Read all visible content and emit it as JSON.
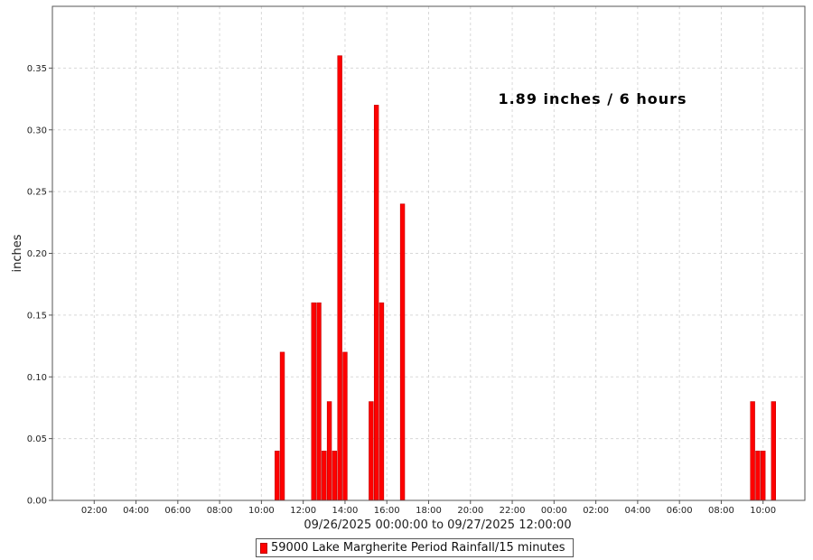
{
  "chart_data": {
    "type": "bar",
    "ylabel": "inches",
    "xlabel": "09/26/2025 00:00:00 to 09/27/2025 12:00:00",
    "x_range": [
      "2025-09-26 00:00",
      "2025-09-27 12:00"
    ],
    "ylim": [
      0,
      0.4
    ],
    "y_ticks": [
      0.0,
      0.05,
      0.1,
      0.15,
      0.2,
      0.25,
      0.3,
      0.35
    ],
    "y_tick_labels": [
      "0.00",
      "0.05",
      "0.10",
      "0.15",
      "0.20",
      "0.25",
      "0.30",
      "0.35"
    ],
    "x_ticks": [
      "2025-09-26 02:00",
      "2025-09-26 04:00",
      "2025-09-26 06:00",
      "2025-09-26 08:00",
      "2025-09-26 10:00",
      "2025-09-26 12:00",
      "2025-09-26 14:00",
      "2025-09-26 16:00",
      "2025-09-26 18:00",
      "2025-09-26 20:00",
      "2025-09-26 22:00",
      "2025-09-27 00:00",
      "2025-09-27 02:00",
      "2025-09-27 04:00",
      "2025-09-27 06:00",
      "2025-09-27 08:00",
      "2025-09-27 10:00"
    ],
    "x_tick_labels": [
      "02:00",
      "04:00",
      "06:00",
      "08:00",
      "10:00",
      "12:00",
      "14:00",
      "16:00",
      "18:00",
      "20:00",
      "22:00",
      "00:00",
      "02:00",
      "04:00",
      "06:00",
      "08:00",
      "10:00"
    ],
    "grid": true,
    "legend_position": "bottom-center",
    "annotation": "1.89 inches / 6 hours",
    "series": [
      {
        "name": "59000 Lake Margherite Period Rainfall/15 minutes",
        "color": "#ff0000",
        "interval_minutes": 15,
        "points": [
          {
            "t": "2025-09-26 10:45",
            "v": 0.04
          },
          {
            "t": "2025-09-26 11:00",
            "v": 0.12
          },
          {
            "t": "2025-09-26 12:30",
            "v": 0.16
          },
          {
            "t": "2025-09-26 12:45",
            "v": 0.16
          },
          {
            "t": "2025-09-26 13:00",
            "v": 0.04
          },
          {
            "t": "2025-09-26 13:15",
            "v": 0.08
          },
          {
            "t": "2025-09-26 13:30",
            "v": 0.04
          },
          {
            "t": "2025-09-26 13:45",
            "v": 0.36
          },
          {
            "t": "2025-09-26 14:00",
            "v": 0.12
          },
          {
            "t": "2025-09-26 15:15",
            "v": 0.08
          },
          {
            "t": "2025-09-26 15:30",
            "v": 0.32
          },
          {
            "t": "2025-09-26 15:45",
            "v": 0.16
          },
          {
            "t": "2025-09-26 16:45",
            "v": 0.24
          },
          {
            "t": "2025-09-27 09:30",
            "v": 0.08
          },
          {
            "t": "2025-09-27 09:45",
            "v": 0.04
          },
          {
            "t": "2025-09-27 10:00",
            "v": 0.04
          },
          {
            "t": "2025-09-27 10:30",
            "v": 0.08
          }
        ]
      }
    ]
  }
}
